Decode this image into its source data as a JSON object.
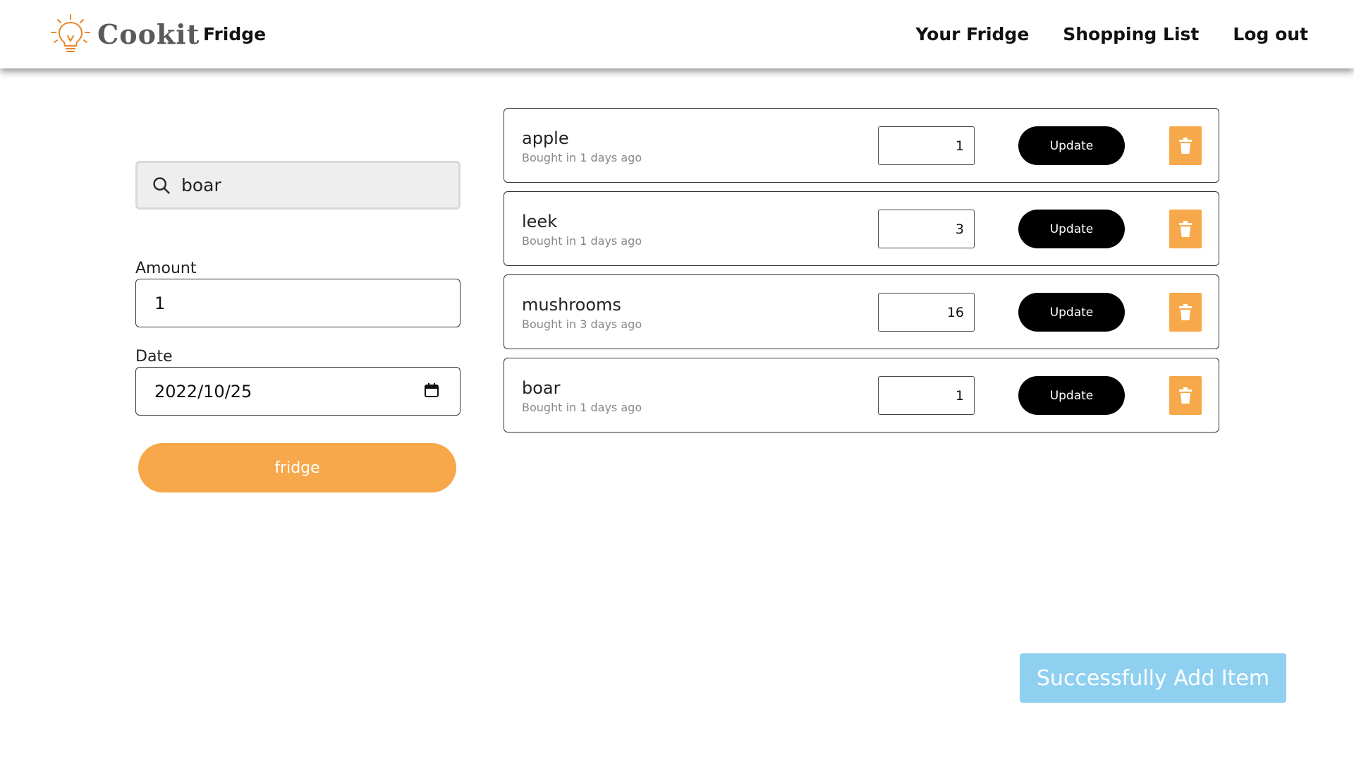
{
  "header": {
    "brand": "Cookit",
    "page_title": "Fridge",
    "nav": [
      "Your Fridge",
      "Shopping List",
      "Log out"
    ]
  },
  "form": {
    "search_value": "boar",
    "amount_label": "Amount",
    "amount_value": "1",
    "date_label": "Date",
    "date_value": "2022/10/25",
    "submit_label": "fridge"
  },
  "items": [
    {
      "name": "apple",
      "subtitle": "Bought in 1 days ago",
      "quantity": "1",
      "update_label": "Update"
    },
    {
      "name": "leek",
      "subtitle": "Bought in 1 days ago",
      "quantity": "3",
      "update_label": "Update"
    },
    {
      "name": "mushrooms",
      "subtitle": "Bought in 3 days ago",
      "quantity": "16",
      "update_label": "Update"
    },
    {
      "name": "boar",
      "subtitle": "Bought in 1 days ago",
      "quantity": "1",
      "update_label": "Update"
    }
  ],
  "toast": {
    "message": "Successfully Add Item"
  },
  "colors": {
    "accent_orange": "#f6a84a",
    "toast_blue": "#8fd0f0",
    "button_black": "#000000"
  },
  "icons": {
    "logo": "lightbulb-icon",
    "search": "search-icon",
    "date": "calendar-icon",
    "delete": "trash-icon"
  }
}
